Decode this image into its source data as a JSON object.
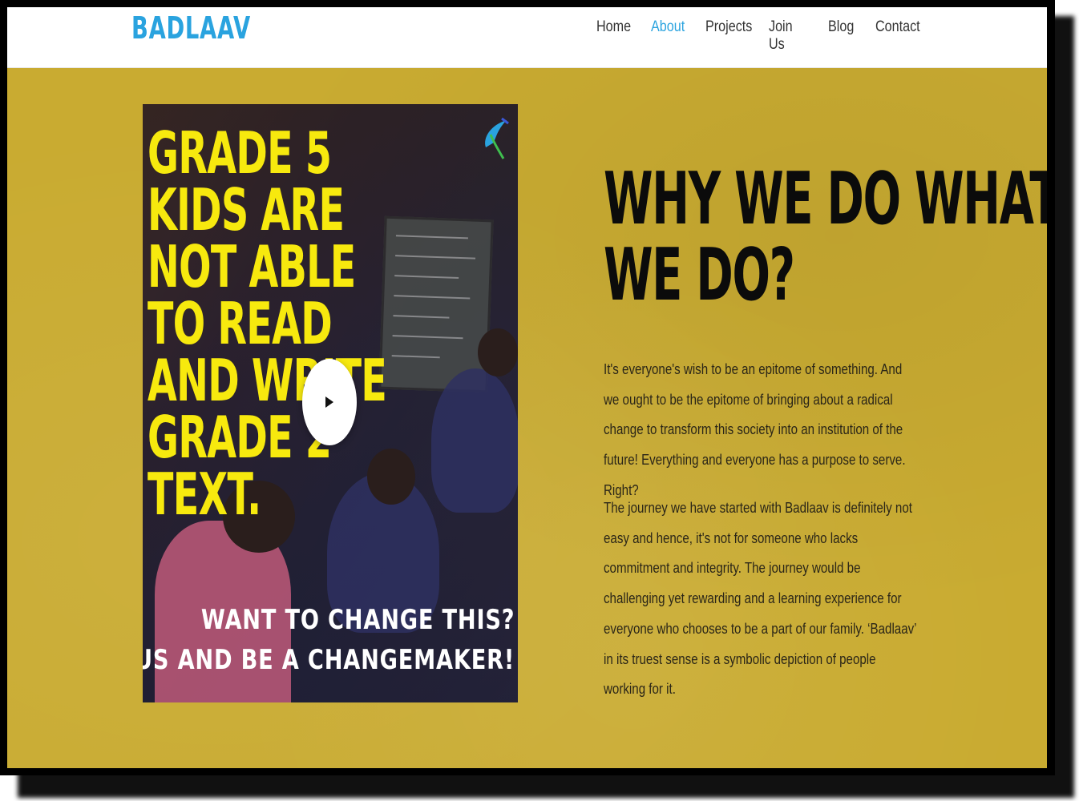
{
  "header": {
    "logo": "BADLAAV",
    "nav": [
      {
        "label": "Home",
        "active": false
      },
      {
        "label": "About",
        "active": true
      },
      {
        "label": "Projects",
        "active": false
      },
      {
        "label": "Join Us",
        "active": false
      },
      {
        "label": "Blog",
        "active": false
      },
      {
        "label": "Contact",
        "active": false
      }
    ]
  },
  "video": {
    "headline": "GRADE 5\nKIDS ARE\nNOT ABLE\nTO READ\nAND WRITE\nGRADE 2\nTEXT.",
    "cta_line1": "WANT TO CHANGE THIS?",
    "cta_line2": "JOIN US AND BE A CHANGEMAKER!",
    "play_icon": "play-icon"
  },
  "about": {
    "title": "WHY WE DO WHAT\nWE DO?",
    "paragraph1": "It's everyone's wish to be an epitome of something. And we ought to be the epitome of bringing about a radical change to transform this society into an institution of the future! Everything and everyone has a purpose to serve. Right?",
    "paragraph2": "The journey we have started with Badlaav is definitely not easy and hence, it's not for someone who lacks commitment and integrity. The journey would be challenging yet rewarding and a learning experience for everyone who chooses to be a part of our family. ‘Badlaav’ in its truest sense is a symbolic depiction of people working for it."
  },
  "colors": {
    "background": "#c9ab31",
    "accent": "#2aa3df",
    "headline": "#f7e90e"
  }
}
